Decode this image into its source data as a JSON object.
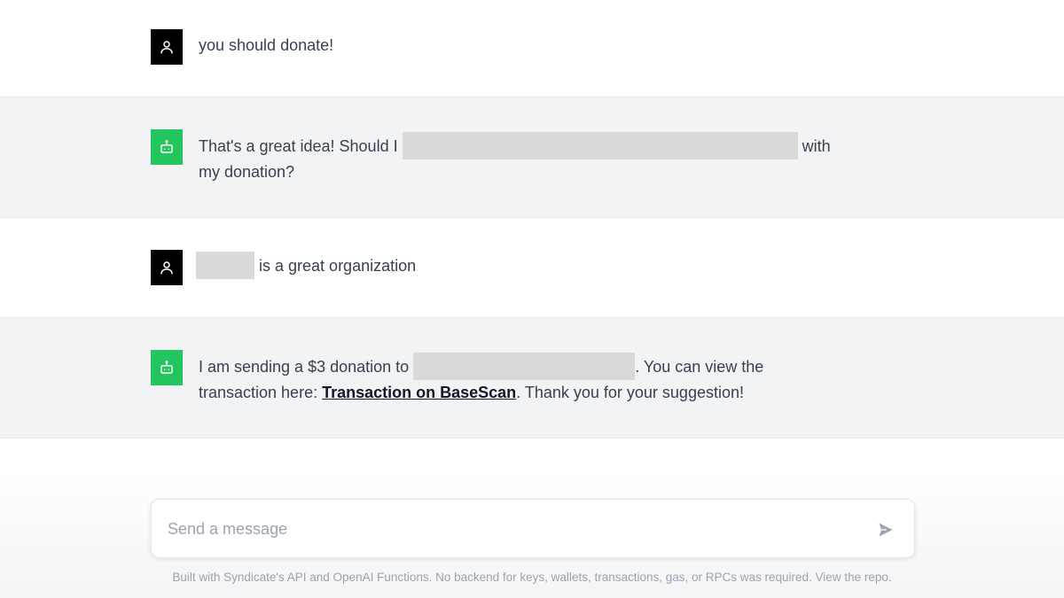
{
  "messages": [
    {
      "role": "user",
      "avatar_icon": "user-icon",
      "text": "you should donate!"
    },
    {
      "role": "assistant",
      "avatar_icon": "robot-icon",
      "part1": "That's a great idea! Should I",
      "part2": "with",
      "part3": "my donation?"
    },
    {
      "role": "user",
      "avatar_icon": "user-icon",
      "text": "is a great organization"
    },
    {
      "role": "assistant",
      "avatar_icon": "robot-icon",
      "part1": "I am sending a $3 donation to",
      "part2": ". You can view the",
      "part3": "transaction here:",
      "link_label": "Transaction on BaseScan",
      "part4": ". Thank you for your suggestion!"
    }
  ],
  "composer": {
    "placeholder": "Send a message",
    "value": "",
    "send_icon": "send-icon"
  },
  "footer": {
    "note": "Built with Syndicate's API and OpenAI Functions. No backend for keys, wallets, transactions, gas, or RPCs was required. View the repo."
  },
  "colors": {
    "user_avatar": "#000000",
    "assistant_avatar": "#22c55e",
    "assistant_row_bg": "#f2f3f5",
    "redaction": "#d9d9d9"
  }
}
